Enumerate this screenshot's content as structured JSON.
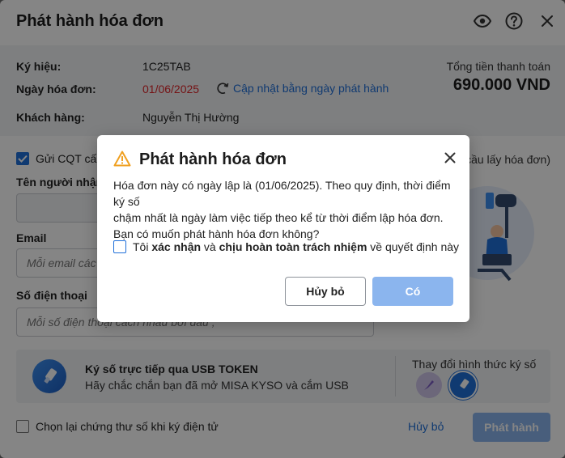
{
  "dialog": {
    "title": "Phát hành hóa đơn",
    "icons": {
      "view": "eye-icon",
      "help": "help-icon",
      "close": "close-icon"
    }
  },
  "invoice": {
    "symbol_label": "Ký hiệu:",
    "symbol_value": "1C25TAB",
    "date_label": "Ngày hóa đơn:",
    "date_value": "01/06/2025",
    "update_link": "Cập nhật bằng ngày phát hành",
    "customer_label": "Khách hàng:",
    "customer_value": "Nguyễn Thị Hường",
    "total_label": "Tổng tiền thanh toán",
    "total_value": "690.000 VND"
  },
  "send": {
    "checkbox_label": "Gửi CQT cấp",
    "right_note": "cầu lấy hóa đơn)",
    "recipient_label": "Tên người nhận",
    "email_label": "Email",
    "email_placeholder": "Mỗi email các",
    "phone_label": "Số điện thoại",
    "phone_placeholder": "Mỗi số điện thoại cách nhau bởi dấu ;"
  },
  "signing": {
    "title": "Ký số trực tiếp qua USB TOKEN",
    "subtitle": "Hãy chắc chắn bạn đã mở MISA KYSO và cắm USB",
    "change_label": "Thay đổi hình thức ký số"
  },
  "footer": {
    "reselect_label": "Chọn lại chứng thư số khi ký điện tử",
    "cancel_label": "Hủy bỏ",
    "publish_label": "Phát hành"
  },
  "modal": {
    "title": "Phát hành hóa đơn",
    "line1": "Hóa đơn này có ngày lập là (01/06/2025). Theo quy định, thời điểm ký số",
    "line2": "chậm nhất là ngày làm việc tiếp theo kể từ thời điểm lập hóa đơn.",
    "line3": "Bạn có muốn phát hành hóa đơn không?",
    "confirm_pre": "Tôi ",
    "confirm_b1": "xác nhận",
    "confirm_mid": " và ",
    "confirm_b2": "chịu hoàn toàn trách nhiệm",
    "confirm_post": " về quyết định này",
    "cancel_label": "Hủy bỏ",
    "ok_label": "Có"
  },
  "colors": {
    "primary": "#1f6fd9",
    "primary_disabled": "#8bb5ee",
    "date_red": "#e0262a",
    "warning": "#f0a020"
  }
}
